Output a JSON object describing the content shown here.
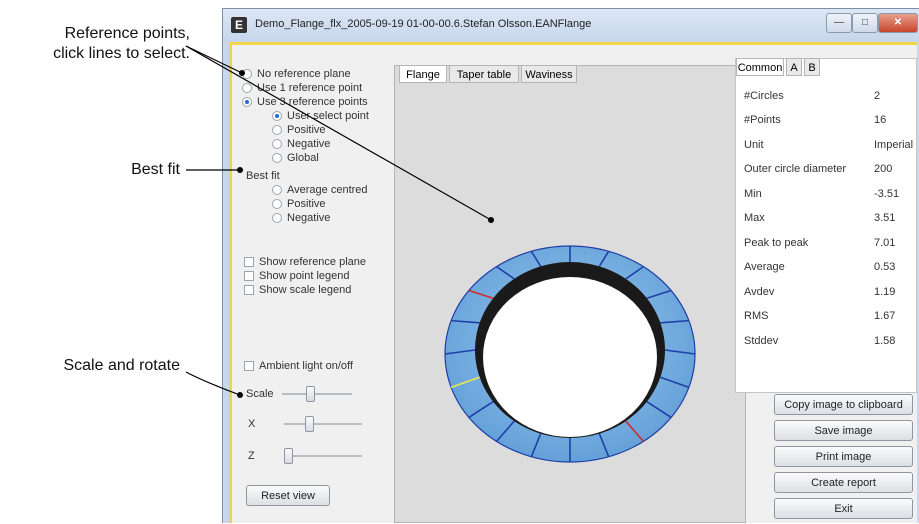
{
  "callouts": {
    "reference_points": "Reference points,",
    "reference_points_2": "click lines to select.",
    "best_fit": "Best fit",
    "scale_rotate": "Scale and rotate"
  },
  "window": {
    "title": "Demo_Flange_flx_2005-09-19 01-00-00.6.Stefan Olsson.EANFlange",
    "icon_letter": "E"
  },
  "left_panel": {
    "reference_options": [
      {
        "label": "No reference plane",
        "checked": false
      },
      {
        "label": "Use 1 reference point",
        "checked": false
      },
      {
        "label": "Use 3 reference points",
        "checked": true
      }
    ],
    "sub_reference_options": [
      {
        "label": "User select point",
        "checked": true
      },
      {
        "label": "Positive",
        "checked": false
      },
      {
        "label": "Negative",
        "checked": false
      },
      {
        "label": "Global",
        "checked": false
      }
    ],
    "best_fit_label": "Best fit",
    "best_fit_options": [
      {
        "label": "Average centred",
        "checked": false
      },
      {
        "label": "Positive",
        "checked": false
      },
      {
        "label": "Negative",
        "checked": false
      }
    ],
    "show_options": [
      {
        "label": "Show reference plane",
        "checked": false
      },
      {
        "label": "Show point legend",
        "checked": false
      },
      {
        "label": "Show scale legend",
        "checked": false
      }
    ],
    "ambient_light": "Ambient light on/off",
    "scale_label": "Scale",
    "x_label": "X",
    "z_label": "Z",
    "scale_value": 0.4,
    "x_value": 0.3,
    "z_value": 0.0,
    "reset_view": "Reset view"
  },
  "view_tabs": [
    "Flange",
    "Taper table",
    "Waviness"
  ],
  "stats_tabs": [
    "Common",
    "A",
    "B"
  ],
  "stats": [
    {
      "key": "#Circles",
      "value": "2"
    },
    {
      "key": "#Points",
      "value": "16"
    },
    {
      "key": "Unit",
      "value": "Imperial"
    },
    {
      "key": "Outer circle diameter",
      "value": "200"
    },
    {
      "key": "Min",
      "value": "-3.51"
    },
    {
      "key": "Max",
      "value": "3.51"
    },
    {
      "key": "Peak to peak",
      "value": "7.01"
    },
    {
      "key": "Average",
      "value": "0.53"
    },
    {
      "key": "Avdev",
      "value": "1.19"
    },
    {
      "key": "RMS",
      "value": "1.67"
    },
    {
      "key": "Stddev",
      "value": "1.58"
    }
  ],
  "action_buttons": [
    "Copy image to clipboard",
    "Save image",
    "Print image",
    "Create report",
    "Exit"
  ],
  "colors": {
    "ring_fill": "#7db3e3",
    "ring_line": "#1f3fa8",
    "ring_inner": "#111111",
    "accent_red": "#d02a2a",
    "accent_yellow": "#e9e94a"
  }
}
